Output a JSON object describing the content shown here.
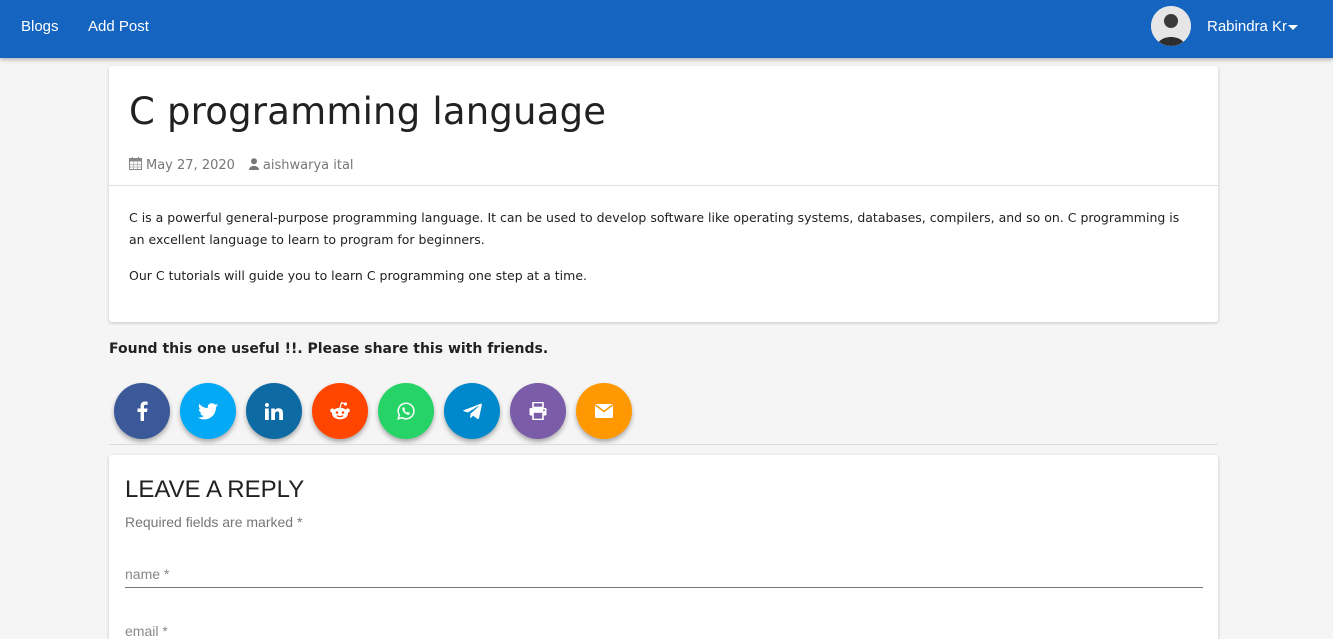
{
  "nav": {
    "links": [
      "Blogs",
      "Add Post"
    ],
    "user_name": "Rabindra Kr",
    "bg_color": "#1565c0"
  },
  "post": {
    "title": "C programming language",
    "date": "May 27, 2020",
    "author": "aishwarya ital",
    "paragraphs": [
      "C is a powerful general-purpose programming language. It can be used to develop software like operating systems, databases, compilers, and so on. C programming is an excellent language to learn to program for beginners.",
      "Our C tutorials will guide you to learn C programming one step at a time."
    ]
  },
  "share": {
    "heading": "Found this one useful !!. Please share this with friends.",
    "buttons": [
      {
        "icon": "facebook-icon",
        "color": "#3b5998"
      },
      {
        "icon": "twitter-icon",
        "color": "#03a9f4"
      },
      {
        "icon": "linkedin-icon",
        "color": "#0d6aa3"
      },
      {
        "icon": "reddit-icon",
        "color": "#ff4500"
      },
      {
        "icon": "whatsapp-icon",
        "color": "#25d366"
      },
      {
        "icon": "telegram-icon",
        "color": "#0088cc"
      },
      {
        "icon": "print-icon",
        "color": "#7b5ca8"
      },
      {
        "icon": "email-icon",
        "color": "#ff9800"
      }
    ]
  },
  "reply": {
    "title": "LEAVE A REPLY",
    "subtitle": "Required fields are marked *",
    "name_placeholder": "name *",
    "email_placeholder": "email *"
  }
}
